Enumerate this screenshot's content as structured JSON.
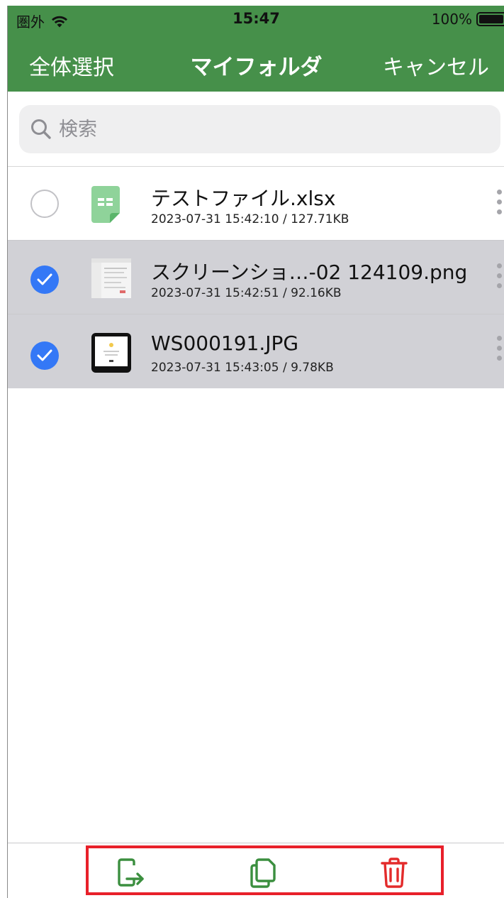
{
  "status_bar": {
    "carrier": "圏外",
    "time": "15:47",
    "battery": "100%"
  },
  "nav": {
    "left_label": "全体選択",
    "title": "マイフォルダ",
    "right_label": "キャンセル"
  },
  "search": {
    "placeholder": "検索"
  },
  "files": [
    {
      "name": "テストファイル.xlsx",
      "meta": "2023-07-31 15:42:10 / 127.71KB",
      "selected": false,
      "icon": "excel-file-icon"
    },
    {
      "name": "スクリーンショ…-02 124109.png",
      "meta": "2023-07-31 15:42:51 / 92.16KB",
      "selected": true,
      "icon": "image-thumbnail"
    },
    {
      "name": "WS000191.JPG",
      "meta": "2023-07-31 15:43:05 / 9.78KB",
      "selected": true,
      "icon": "image-thumbnail"
    }
  ],
  "toolbar": {
    "icons": [
      "move-out-icon",
      "copy-icon",
      "trash-icon"
    ]
  },
  "colors": {
    "header_green": "#46904a",
    "accent_blue": "#3478f6",
    "toolbar_green": "#3b8f3f",
    "delete_red": "#e32b2b",
    "highlight_border": "#e8202a"
  }
}
